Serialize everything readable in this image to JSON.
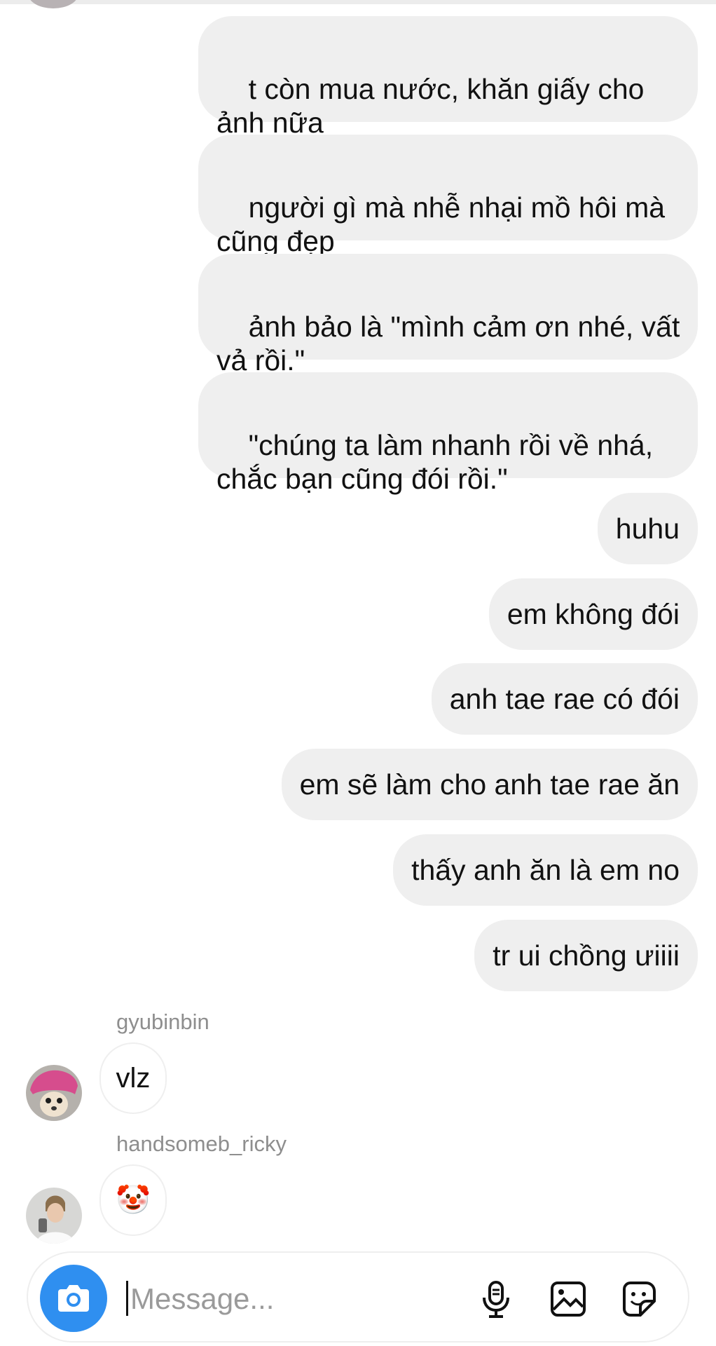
{
  "outgoing_messages": [
    {
      "text": "t còn mua nước, khăn giấy cho ảnh nữa"
    },
    {
      "text": "người gì mà nhễ nhại mồ hôi mà cũng đẹp"
    },
    {
      "text": "ảnh bảo là \"mình cảm ơn nhé, vất vả rồi.\""
    },
    {
      "text": "\"chúng ta làm nhanh rồi về nhá, chắc bạn cũng đói rồi.\""
    },
    {
      "text": "huhu"
    },
    {
      "text": "em không đói"
    },
    {
      "text": "anh tae rae có đói"
    },
    {
      "text": "em sẽ làm cho anh tae rae ăn"
    },
    {
      "text": "thấy anh ăn là em no"
    },
    {
      "text": "tr ui chồng ưiiii"
    }
  ],
  "incoming_messages": [
    {
      "username": "gyubinbin",
      "text": "vlz",
      "avatar": "dog-avatar"
    },
    {
      "username": "handsomeb_ricky",
      "text": "🤡",
      "avatar": "person-avatar"
    }
  ],
  "composer": {
    "placeholder": "Message...",
    "camera_icon": "camera-icon",
    "mic_icon": "microphone-icon",
    "gallery_icon": "image-gallery-icon",
    "sticker_icon": "sticker-icon",
    "accent_color": "#2f8ff0"
  }
}
